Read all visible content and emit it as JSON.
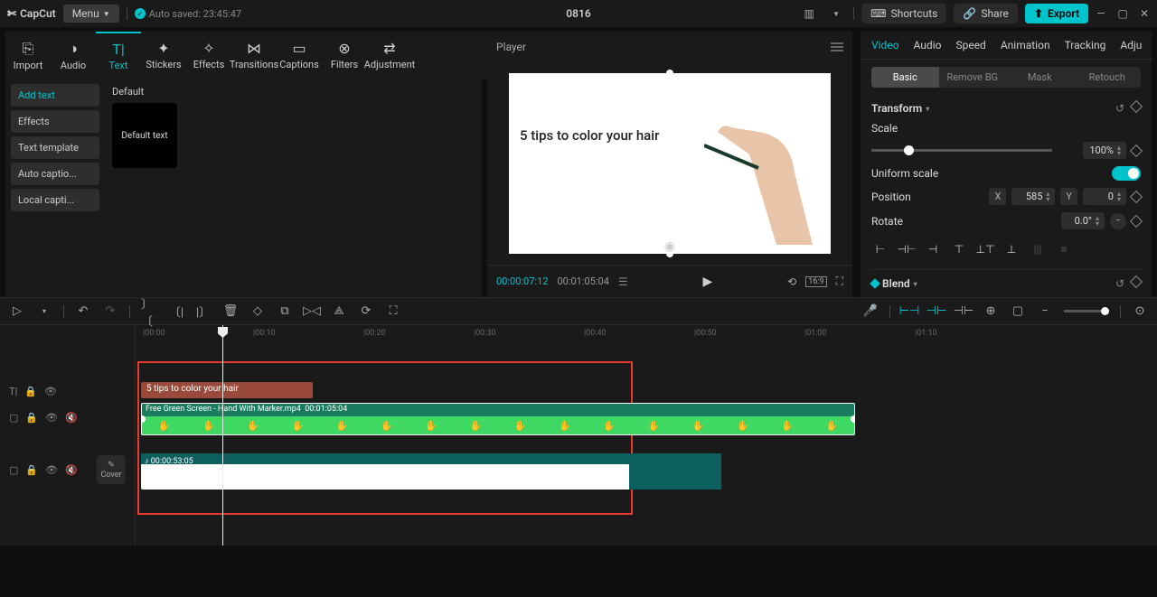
{
  "titlebar": {
    "app_name": "CapCut",
    "menu_label": "Menu",
    "autosave": "Auto saved: 23:45:47",
    "project_title": "0816",
    "shortcuts_label": "Shortcuts",
    "share_label": "Share",
    "export_label": "Export"
  },
  "toolbar_tabs": [
    {
      "label": "Import",
      "icon": "⎘"
    },
    {
      "label": "Audio",
      "icon": "◑"
    },
    {
      "label": "Text",
      "icon": "T|"
    },
    {
      "label": "Stickers",
      "icon": "✦"
    },
    {
      "label": "Effects",
      "icon": "✧"
    },
    {
      "label": "Transitions",
      "icon": "⋈"
    },
    {
      "label": "Captions",
      "icon": "▭"
    },
    {
      "label": "Filters",
      "icon": "⊗"
    },
    {
      "label": "Adjustment",
      "icon": "⇄"
    }
  ],
  "left_sidebar_items": [
    "Add text",
    "Effects",
    "Text template",
    "Auto captio...",
    "Local capti..."
  ],
  "left_content": {
    "group_label": "Default",
    "card_label": "Default text"
  },
  "player": {
    "title": "Player",
    "preview_text": "5 tips to color your hair",
    "time_current": "00:00:07:12",
    "time_total": "00:01:05:04"
  },
  "props": {
    "tabs": [
      "Video",
      "Audio",
      "Speed",
      "Animation",
      "Tracking",
      "Adju"
    ],
    "seg_tabs": [
      "Basic",
      "Remove BG",
      "Mask",
      "Retouch"
    ],
    "transform_label": "Transform",
    "scale_label": "Scale",
    "scale_value": "100%",
    "uniform_scale_label": "Uniform scale",
    "position_label": "Position",
    "x_label": "X",
    "x_value": "585",
    "y_label": "Y",
    "y_value": "0",
    "rotate_label": "Rotate",
    "rotate_value": "0.0°",
    "blend_label": "Blend"
  },
  "timeline": {
    "ruler_ticks": [
      "|00:00",
      "|00:10",
      "|00:20",
      "|00:30",
      "|00:40",
      "|00:50",
      "|01:00",
      "|01:10"
    ],
    "text_clip_label": "5 tips to color your hair",
    "video_clip_name": "Free Green Screen - Hand With Marker.mp4",
    "video_clip_time": "00:01:05:04",
    "audio_clip_time": "00:00:53:05",
    "cover_label": "Cover"
  }
}
